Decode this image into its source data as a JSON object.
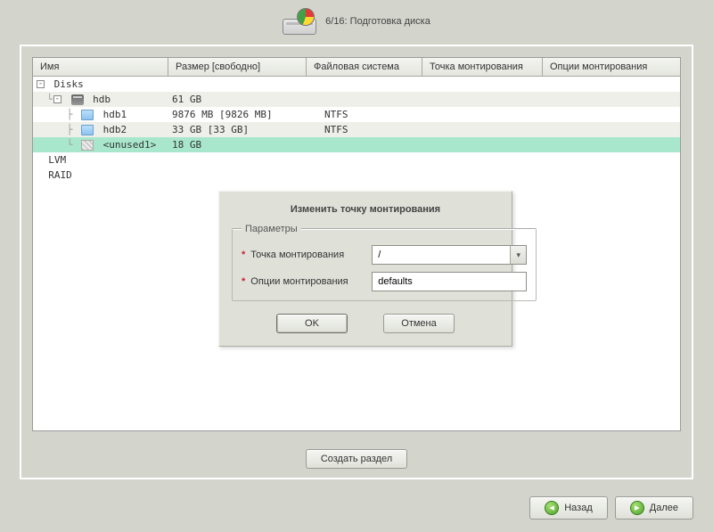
{
  "header": {
    "title": "6/16: Подготовка диска"
  },
  "columns": {
    "name": "Имя",
    "size": "Размер [свободно]",
    "fs": "Файловая система",
    "mount": "Точка монтирования",
    "options": "Опции монтирования"
  },
  "tree": {
    "root": "Disks",
    "hdb": {
      "name": "hdb",
      "size": "61 GB"
    },
    "hdb1": {
      "name": "hdb1",
      "size": "9876 MB [9826 MB]",
      "fs": "NTFS"
    },
    "hdb2": {
      "name": "hdb2",
      "size": "33 GB [33 GB]",
      "fs": "NTFS"
    },
    "unused": {
      "name": "<unused1>",
      "size": "18 GB"
    },
    "lvm": "LVM",
    "raid": "RAID"
  },
  "dialog": {
    "title": "Изменить точку монтирования",
    "group": "Параметры",
    "mount_label": "Точка монтирования",
    "mount_value": "/",
    "options_label": "Опции монтирования",
    "options_value": "defaults",
    "ok": "OK",
    "cancel": "Отмена"
  },
  "buttons": {
    "create": "Создать раздел",
    "back": "Назад",
    "next": "Далее"
  }
}
